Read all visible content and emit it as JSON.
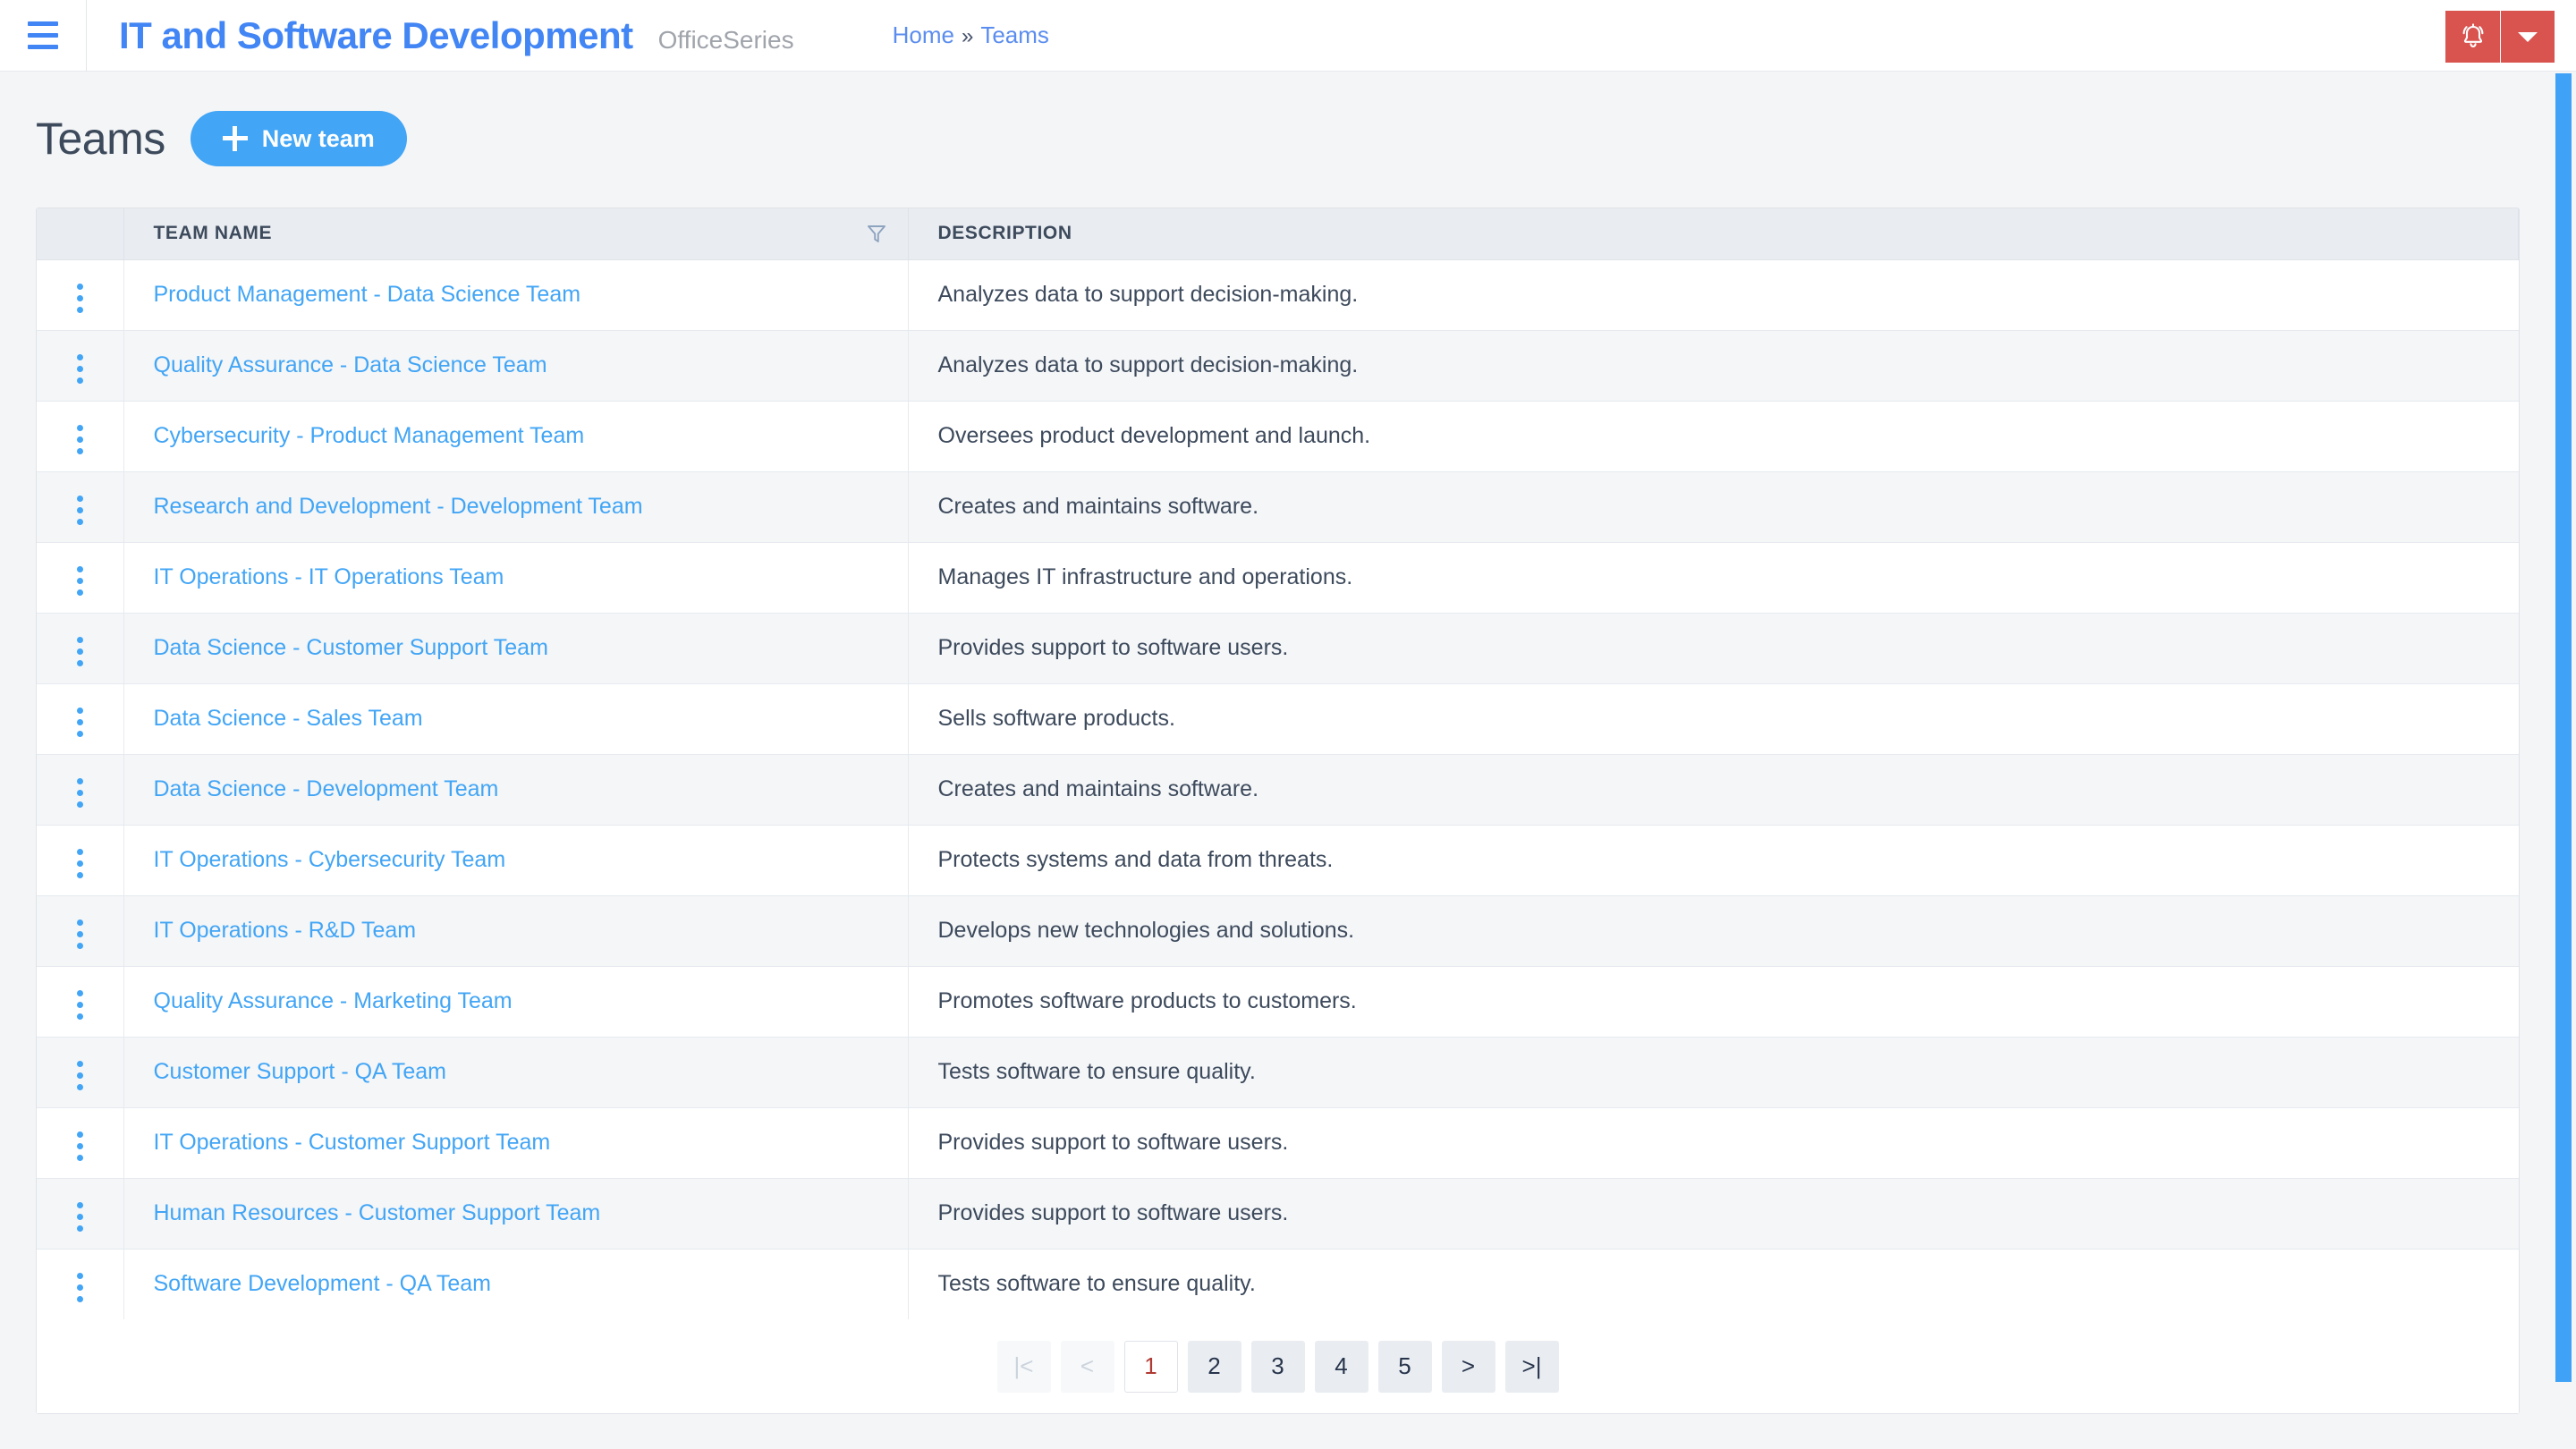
{
  "header": {
    "menu_icon": "hamburger-icon",
    "app_title": "IT and Software Development",
    "app_subtitle": "OfficeSeries",
    "breadcrumb": {
      "home": "Home",
      "separator": "»",
      "current": "Teams"
    },
    "alert_icon": "bell-icon",
    "alert_caret_icon": "caret-down-icon",
    "alert_color": "#d9534f"
  },
  "page": {
    "title": "Teams",
    "new_button_label": "New team",
    "new_button_icon": "plus-icon",
    "accent_color": "#42a5f5"
  },
  "table": {
    "columns": [
      "",
      "TEAM NAME",
      "DESCRIPTION"
    ],
    "filter_icon": "funnel-filter-icon",
    "row_menu_icon": "kebab-menu-icon",
    "rows": [
      {
        "name": "Product Management - Data Science Team",
        "description": "Analyzes data to support decision-making."
      },
      {
        "name": "Quality Assurance - Data Science Team",
        "description": "Analyzes data to support decision-making."
      },
      {
        "name": "Cybersecurity - Product Management Team",
        "description": "Oversees product development and launch."
      },
      {
        "name": "Research and Development - Development Team",
        "description": "Creates and maintains software."
      },
      {
        "name": "IT Operations - IT Operations Team",
        "description": "Manages IT infrastructure and operations."
      },
      {
        "name": "Data Science - Customer Support Team",
        "description": "Provides support to software users."
      },
      {
        "name": "Data Science - Sales Team",
        "description": "Sells software products."
      },
      {
        "name": "Data Science - Development Team",
        "description": "Creates and maintains software."
      },
      {
        "name": "IT Operations - Cybersecurity Team",
        "description": "Protects systems and data from threats."
      },
      {
        "name": "IT Operations - R&D Team",
        "description": "Develops new technologies and solutions."
      },
      {
        "name": "Quality Assurance - Marketing Team",
        "description": "Promotes software products to customers."
      },
      {
        "name": "Customer Support - QA Team",
        "description": "Tests software to ensure quality."
      },
      {
        "name": "IT Operations - Customer Support Team",
        "description": "Provides support to software users."
      },
      {
        "name": "Human Resources - Customer Support Team",
        "description": "Provides support to software users."
      },
      {
        "name": "Software Development - QA Team",
        "description": "Tests software to ensure quality."
      }
    ]
  },
  "pagination": {
    "first_label": "|<",
    "prev_label": "<",
    "next_label": ">",
    "last_label": ">|",
    "pages": [
      "1",
      "2",
      "3",
      "4",
      "5"
    ],
    "active_page": "1",
    "active_color": "#b03a34"
  }
}
